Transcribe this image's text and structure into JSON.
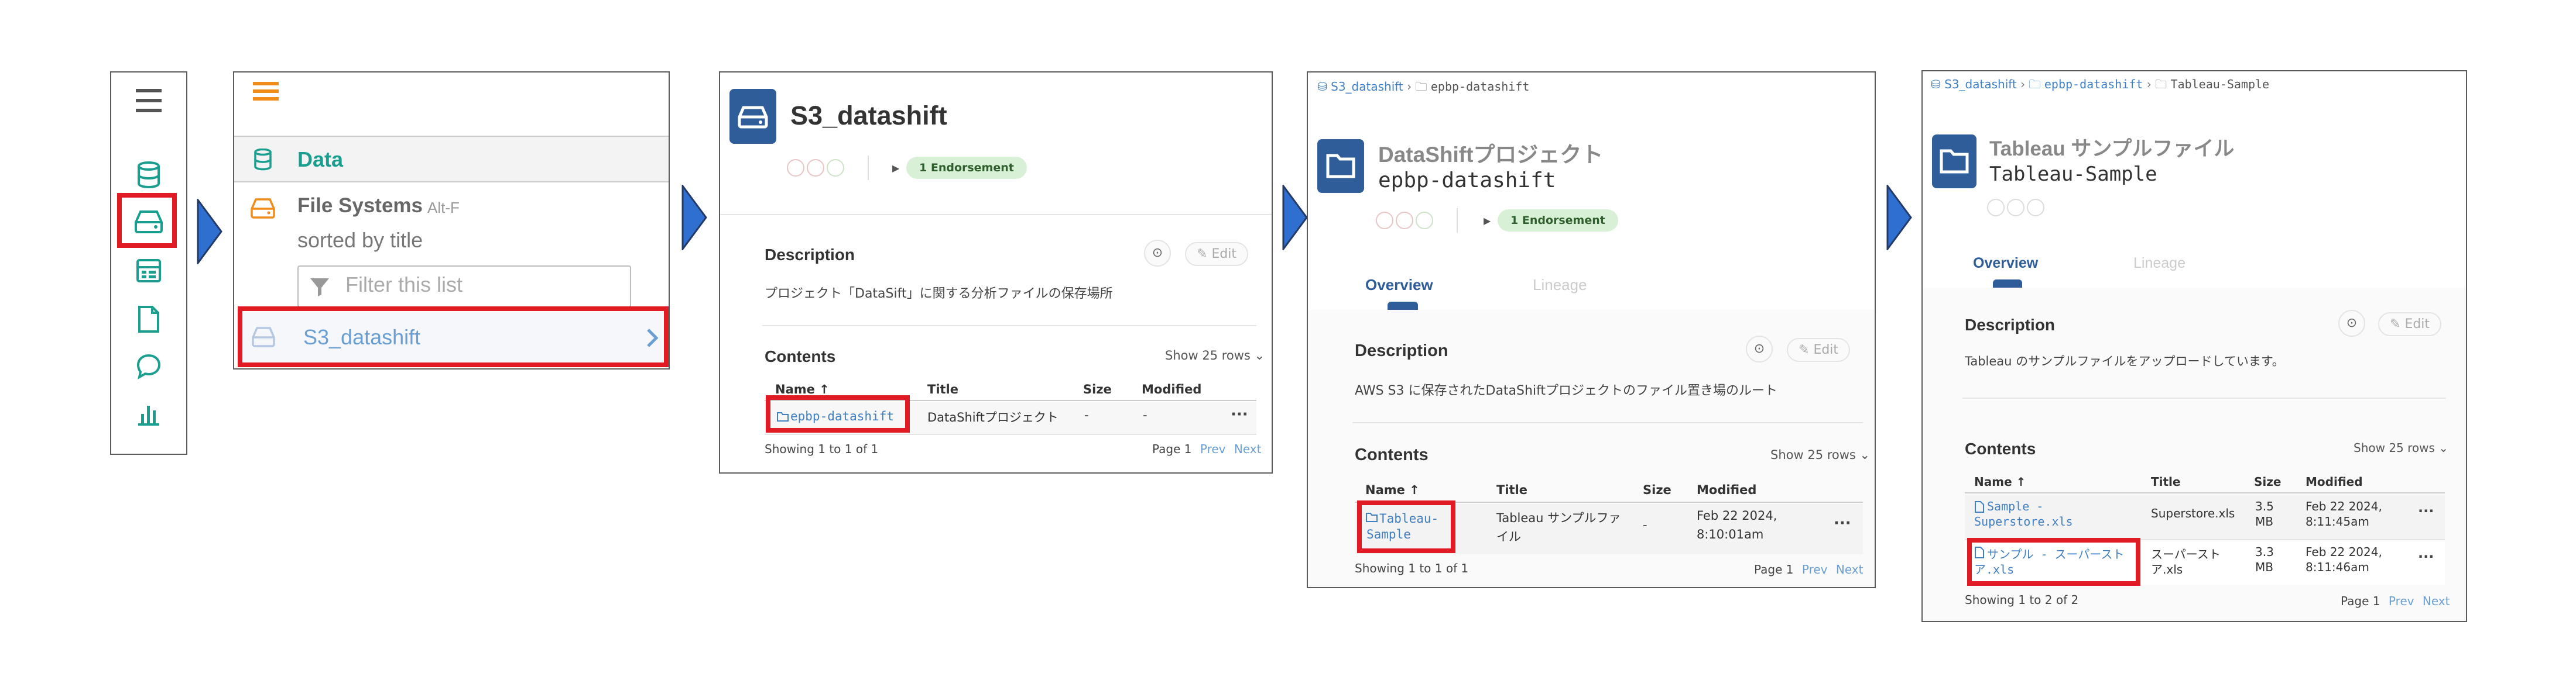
{
  "colors": {
    "highlight": "#e01b24",
    "arrow": "#2f6fd0",
    "teal": "#1a9e8f",
    "orange": "#f08c1a",
    "link": "#3f7fc2",
    "folder_bg": "#2f5d9a"
  },
  "panel1": {
    "icons": [
      "menu-icon",
      "database-icon",
      "drive-icon",
      "table-icon",
      "document-icon",
      "chat-icon",
      "chart-icon"
    ]
  },
  "panel2": {
    "data_label": "Data",
    "file_systems_label": "File Systems",
    "shortcut": "Alt-F",
    "sorted_by": "sorted by title",
    "filter_placeholder": "Filter this list",
    "item": "S3_datashift"
  },
  "panel3": {
    "title": "S3_datashift",
    "endorsement": "1 Endorsement",
    "description_heading": "Description",
    "edit_label": "Edit",
    "description": "プロジェクト「DataSift」に関する分析ファイルの保存場所",
    "contents_heading": "Contents",
    "show_rows": "Show 25 rows",
    "columns": [
      "Name ↑",
      "Title",
      "Size",
      "Modified"
    ],
    "row": {
      "name": "epbp-datashift",
      "title": "DataShiftプロジェクト",
      "size": "-",
      "modified": "-"
    },
    "showing": "Showing 1 to 1 of 1",
    "page": "Page 1",
    "prev": "Prev",
    "next": "Next"
  },
  "panel4": {
    "breadcrumb": [
      "S3_datashift",
      "epbp-datashift"
    ],
    "title": "DataShiftプロジェクト",
    "subtitle": "epbp-datashift",
    "endorsement": "1 Endorsement",
    "tabs": [
      "Overview",
      "Lineage"
    ],
    "description_heading": "Description",
    "edit_label": "Edit",
    "description": "AWS S3 に保存されたDataShiftプロジェクトのファイル置き場のルート",
    "contents_heading": "Contents",
    "show_rows": "Show 25 rows",
    "columns": [
      "Name ↑",
      "Title",
      "Size",
      "Modified"
    ],
    "row": {
      "name_l1": "Tableau-",
      "name_l2": "Sample",
      "title_l1": "Tableau サンプルファ",
      "title_l2": "イル",
      "size": "-",
      "modified_l1": "Feb 22 2024,",
      "modified_l2": "8:10:01am"
    },
    "showing": "Showing 1 to 1 of 1",
    "page": "Page 1",
    "prev": "Prev",
    "next": "Next"
  },
  "panel5": {
    "breadcrumb": [
      "S3_datashift",
      "epbp-datashift",
      "Tableau-Sample"
    ],
    "title": "Tableau サンプルファイル",
    "subtitle": "Tableau-Sample",
    "tabs": [
      "Overview",
      "Lineage"
    ],
    "description_heading": "Description",
    "edit_label": "Edit",
    "description": "Tableau のサンプルファイルをアップロードしています。",
    "contents_heading": "Contents",
    "show_rows": "Show 25 rows",
    "columns": [
      "Name ↑",
      "Title",
      "Size",
      "Modified"
    ],
    "rows": [
      {
        "name_l1": "Sample -",
        "name_l2": "Superstore.xls",
        "title_l1": "Superstore.xls",
        "title_l2": "",
        "size_l1": "3.5",
        "size_l2": "MB",
        "mod_l1": "Feb 22 2024,",
        "mod_l2": "8:11:45am"
      },
      {
        "name_l1": "サンプル - スーパースト",
        "name_l2": "ア.xls",
        "title_l1": "スーパースト",
        "title_l2": "ア.xls",
        "size_l1": "3.3",
        "size_l2": "MB",
        "mod_l1": "Feb 22 2024,",
        "mod_l2": "8:11:46am"
      }
    ],
    "showing": "Showing 1 to 2 of 2",
    "page": "Page 1",
    "prev": "Prev",
    "next": "Next"
  }
}
